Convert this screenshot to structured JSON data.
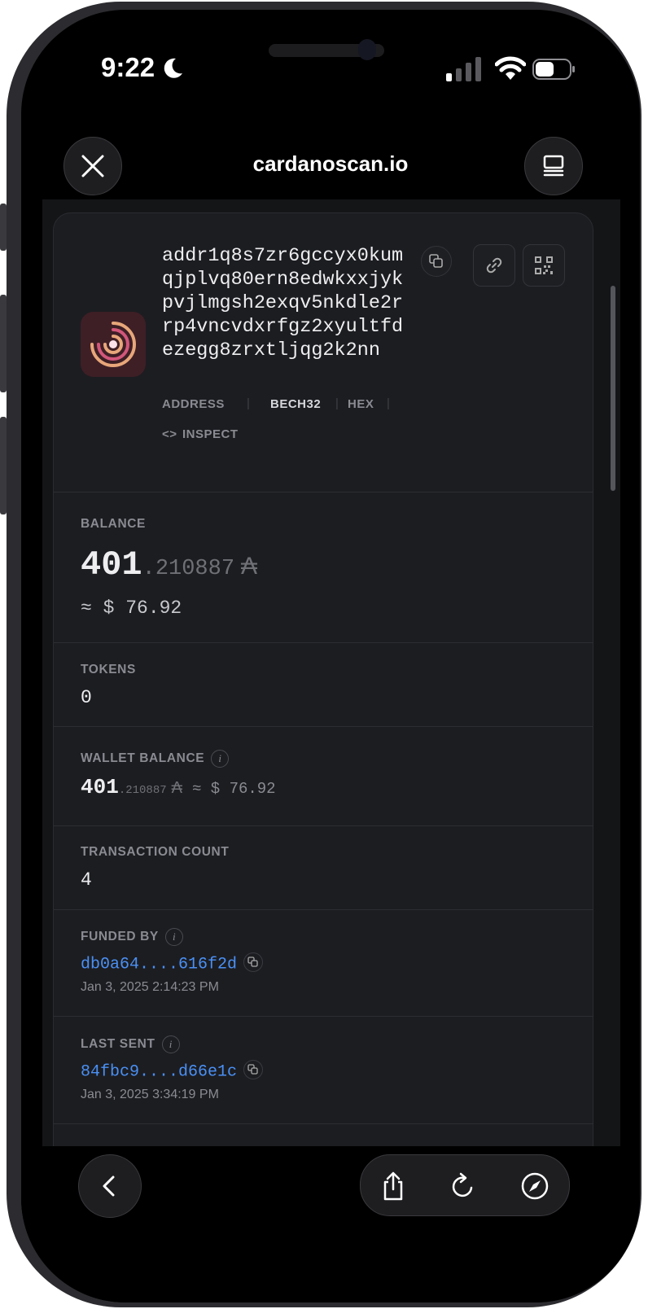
{
  "status_bar": {
    "time": "9:22"
  },
  "browser": {
    "domain": "cardanoscan.io"
  },
  "address": {
    "value": "addr1q8s7zr6gccyx0kumqjplvq80ern8edwkxxjykpvjlmgsh2exqv5nkdle2rrp4vncvdxrfgz2xyultfdezegg8zrxtljqg2k2nn",
    "tag_address": "ADDRESS",
    "tag_bech32": "BECH32",
    "tag_hex": "HEX",
    "inspect_label": "INSPECT"
  },
  "balance": {
    "label": "BALANCE",
    "integer": "401",
    "decimal": ".210887",
    "currency_symbol": "₳",
    "usd": "≈ $ 76.92"
  },
  "tokens": {
    "label": "TOKENS",
    "value": "0"
  },
  "wallet_balance": {
    "label": "WALLET BALANCE",
    "integer": "401",
    "decimal": ".210887",
    "currency_symbol": "₳",
    "usd": "≈ $ 76.92"
  },
  "transaction_count": {
    "label": "TRANSACTION COUNT",
    "value": "4"
  },
  "funded_by": {
    "label": "FUNDED BY",
    "hash": "db0a64....616f2d",
    "date": "Jan 3, 2025 2:14:23 PM"
  },
  "last_sent": {
    "label": "LAST SENT",
    "hash": "84fbc9....d66e1c",
    "date": "Jan 3, 2025 3:34:19 PM"
  },
  "colors": {
    "accent_link": "#4a90f5",
    "card_bg": "#1c1d21",
    "logo_ring": "#e8a77a"
  }
}
